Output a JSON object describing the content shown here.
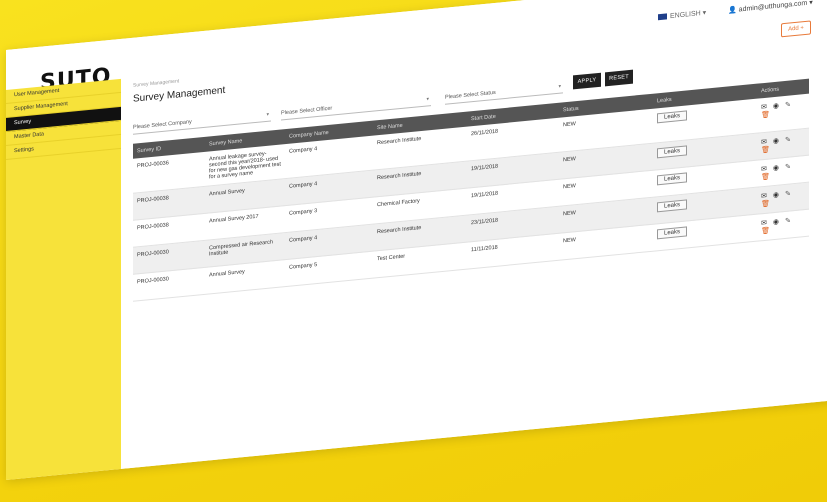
{
  "brand": {
    "logo_text": "SUTO",
    "accent": "#f2c200"
  },
  "header": {
    "language": "ENGLISH",
    "user": "admin@utthunga.com"
  },
  "sidebar": {
    "items": [
      {
        "label": "User Management"
      },
      {
        "label": "Supplier Management"
      },
      {
        "label": "Survey",
        "active": true
      },
      {
        "label": "Master Data"
      },
      {
        "label": "Settings"
      }
    ]
  },
  "page": {
    "breadcrumb": "Survey Management",
    "title": "Survey Management",
    "add_label": "Add +"
  },
  "filters": {
    "company_placeholder": "Please Select Company",
    "officer_placeholder": "Please Select Officer",
    "status_placeholder": "Please Select Status",
    "apply_label": "APPLY",
    "reset_label": "RESET"
  },
  "table": {
    "columns": [
      "Survey ID",
      "Survey Name",
      "Company Name",
      "Site Name",
      "Start Date",
      "Status",
      "Leaks",
      "Actions"
    ],
    "rows": [
      {
        "id": "PROJ-00036",
        "name": "Annual leakage survey- second this year/2018- used for new gas development test for a survey name",
        "company": "Company 4",
        "site": "Research Institute",
        "date": "26/11/2018",
        "status": "NEW",
        "leaks": "Leaks"
      },
      {
        "id": "PROJ-00038",
        "name": "Annual Survey",
        "company": "Company 4",
        "site": "Research Institute",
        "date": "19/11/2018",
        "status": "NEW",
        "leaks": "Leaks"
      },
      {
        "id": "PROJ-00038",
        "name": "Annual Survey 2017",
        "company": "Company 3",
        "site": "Chemical Factory",
        "date": "19/11/2018",
        "status": "NEW",
        "leaks": "Leaks"
      },
      {
        "id": "PROJ-00030",
        "name": "Compressed air Research Institute",
        "company": "Company 4",
        "site": "Research Institute",
        "date": "23/11/2018",
        "status": "NEW",
        "leaks": "Leaks"
      },
      {
        "id": "PROJ-00030",
        "name": "Annual Survey",
        "company": "Company 5",
        "site": "Test Center",
        "date": "11/11/2018",
        "status": "NEW",
        "leaks": "Leaks"
      }
    ]
  }
}
